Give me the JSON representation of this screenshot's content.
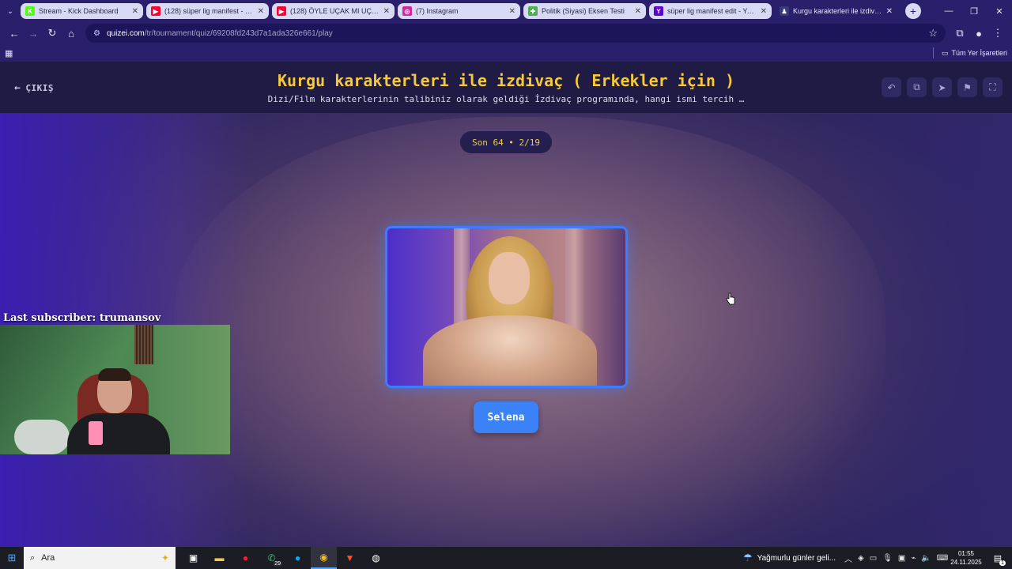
{
  "browser": {
    "tabs": [
      {
        "title": "Stream - Kick Dashboard",
        "favicon": "kick-icon",
        "color": "#53fc18",
        "glyph": "K"
      },
      {
        "title": "(128) süper lig manifest - YouTube",
        "favicon": "youtube-icon",
        "color": "#ff0033",
        "glyph": "▶"
      },
      {
        "title": "(128) ÖYLE UÇAK MI UÇAR | ...",
        "favicon": "youtube-icon",
        "color": "#ff0033",
        "glyph": "▶"
      },
      {
        "title": "(7) Instagram",
        "favicon": "instagram-icon",
        "color": "#d6249f",
        "glyph": "◎"
      },
      {
        "title": "Politik (Siyasi) Eksen Testi",
        "favicon": "politik-icon",
        "color": "#4caf50",
        "glyph": "✚"
      },
      {
        "title": "süper lig manifest edit - Yahoo",
        "favicon": "yahoo-icon",
        "color": "#6001d2",
        "glyph": "Y"
      },
      {
        "title": "Kurgu karakterleri ile izdivaç (...)",
        "favicon": "quizei-icon",
        "color": "#3a3a7a",
        "glyph": "♟"
      }
    ],
    "url_host": "quizei.com",
    "url_path": "/tr/tournament/quiz/69208fd243d7a1ada326e661/play",
    "bookmarks_all_label": "Tüm Yer İşaretleri"
  },
  "quiz": {
    "exit_label": "ÇIKIŞ",
    "title": "Kurgu karakterleri ile izdivaç ( Erkekler için )",
    "subtitle": "Dizi/Film karakterlerinin talibiniz olarak geldiği İzdivaç programında, hangi ismi tercih …",
    "round": "Son 64 • 2/19",
    "choice_label": "Selena",
    "tools": [
      "undo-icon",
      "share-icon",
      "send-icon",
      "flag-icon",
      "fullscreen-icon"
    ]
  },
  "stream_overlay": {
    "last_subscriber": "Last subscriber: trumansov"
  },
  "taskbar": {
    "search_placeholder": "Ara",
    "whatsapp_badge": "29",
    "weather_text": "Yağmurlu günler geli...",
    "time": "01:55",
    "date": "24.11.2025",
    "notification_count": "1"
  }
}
